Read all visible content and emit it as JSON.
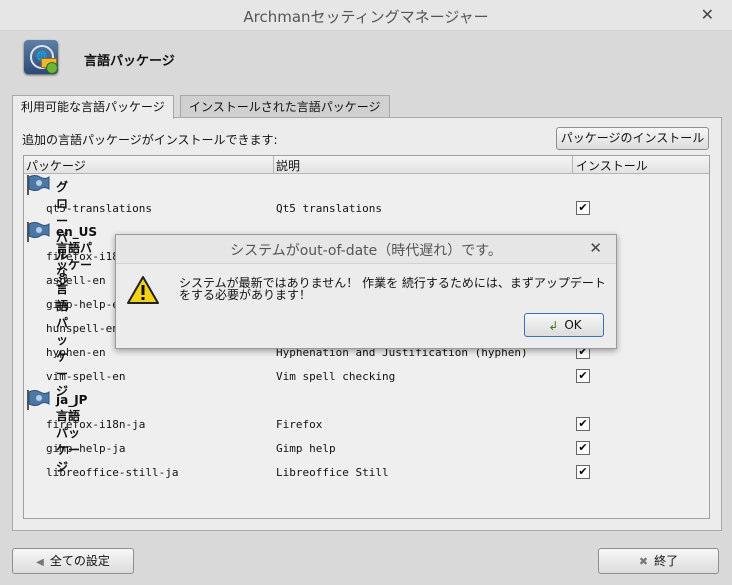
{
  "window": {
    "title": "Archmanセッティングマネージャー"
  },
  "header": {
    "title": "言語パッケージ"
  },
  "tabs": [
    {
      "label": "利用可能な言語パッケージ",
      "active": true
    },
    {
      "label": "インストールされた言語パッケージ",
      "active": false
    }
  ],
  "panel": {
    "info": "追加の言語パッケージがインストールできます:",
    "install_button": "パッケージのインストール"
  },
  "columns": [
    "パッケージ",
    "説明",
    "インストール"
  ],
  "groups": [
    {
      "label": "グローバルな言語パッケージ",
      "items": [
        {
          "name": "qt5-translations",
          "desc": "Qt5 translations",
          "checked": true
        }
      ]
    },
    {
      "label": "en_US 言語パッケージ",
      "items": [
        {
          "name": "firefox-i18n",
          "desc": "",
          "checked": true
        },
        {
          "name": "aspell-en",
          "desc": "",
          "checked": true
        },
        {
          "name": "gimp-help-en",
          "desc": "",
          "checked": true
        },
        {
          "name": "hunspell-en",
          "desc": "",
          "checked": true
        },
        {
          "name": "hyphen-en",
          "desc": "Hyphenation and Justification (hyphen)",
          "checked": true
        },
        {
          "name": "vim-spell-en",
          "desc": "Vim spell checking",
          "checked": true
        }
      ]
    },
    {
      "label": "ja_JP 言語パッケージ",
      "items": [
        {
          "name": "firefox-i18n-ja",
          "desc": "Firefox",
          "checked": true
        },
        {
          "name": "gimp-help-ja",
          "desc": "Gimp help",
          "checked": true
        },
        {
          "name": "libreoffice-still-ja",
          "desc": "Libreoffice Still",
          "checked": true
        }
      ]
    }
  ],
  "footer": {
    "all_settings": "全ての設定",
    "quit": "終了"
  },
  "dialog": {
    "title": "システムがout-of-date（時代遅れ）です。",
    "message": "システムが最新ではありません！ 作業を 続行するためには、まずアップデートをする必要があります！",
    "ok_label": "OK"
  },
  "icons": {
    "checkmark": "✔",
    "close": "✕",
    "warning": "warning-icon",
    "flag": "flag-icon"
  }
}
